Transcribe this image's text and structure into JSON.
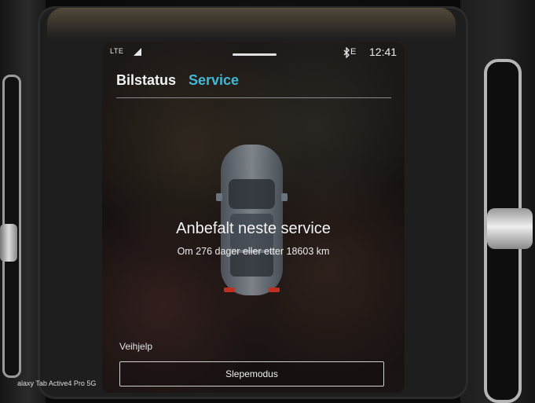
{
  "status_bar": {
    "network_left": "LTE",
    "network_right": "E",
    "time": "12:41",
    "icons": [
      "signal-icon",
      "bluetooth-icon"
    ]
  },
  "tabs": [
    {
      "label": "Bilstatus",
      "active": false
    },
    {
      "label": "Service",
      "active": true
    }
  ],
  "service": {
    "title": "Anbefalt neste service",
    "subtitle": "Om 276 dager eller etter 18603 km"
  },
  "roadside": {
    "label": "Veihjelp",
    "tow_mode_button": "Slepemodus"
  },
  "watermark": "alaxy Tab Active4 Pro 5G",
  "colors": {
    "accent": "#3fb9d6",
    "text": "#f2f2f2"
  }
}
